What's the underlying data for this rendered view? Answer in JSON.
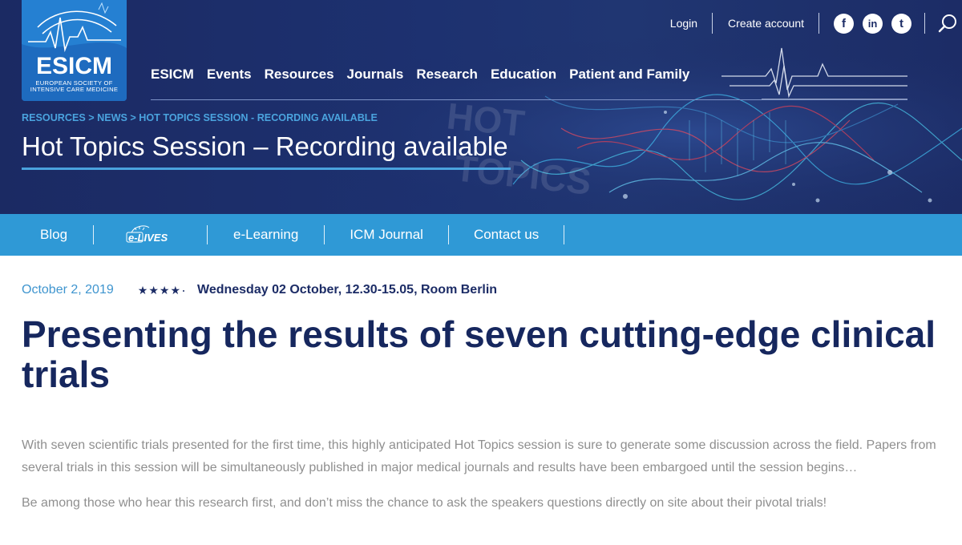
{
  "logo": {
    "name": "ESICM",
    "subtitle": "European Society of Intensive Care Medicine"
  },
  "topnav": {
    "login": "Login",
    "create_account": "Create account",
    "social": [
      {
        "icon": "facebook-icon",
        "glyph": "f"
      },
      {
        "icon": "linkedin-icon",
        "glyph": "in"
      },
      {
        "icon": "twitter-icon",
        "glyph": "t"
      }
    ],
    "search_icon": "search-icon"
  },
  "mainnav": [
    "ESICM",
    "Events",
    "Resources",
    "Journals",
    "Research",
    "Education",
    "Patient and Family"
  ],
  "breadcrumb": {
    "items": [
      "RESOURCES",
      "NEWS",
      "HOT TOPICS SESSION - RECORDING AVAILABLE"
    ],
    "separator": " > "
  },
  "page_title": "Hot Topics Session – Recording available",
  "banner_text": [
    "HOT",
    "TOPICS"
  ],
  "subnav": {
    "blog": "Blog",
    "elives_logo": "e-LIVES",
    "elearning": "e-Learning",
    "icm_journal": "ICM Journal",
    "contact": "Contact us"
  },
  "article": {
    "date": "October 2, 2019",
    "rating_stars": 4,
    "session_info": "Wednesday 02 October, 12.30-15.05, Room Berlin",
    "headline": "Presenting the results of seven cutting-edge clinical trials",
    "paragraphs": [
      "With seven scientific trials presented for the first time, this highly anticipated Hot Topics session is sure to generate some discussion across the field. Papers from several trials in this session will be simultaneously published in major medical journals and results have been embargoed until the session begins…",
      "Be among those who hear this research first, and don’t miss the chance to ask the speakers questions directly on site about their pivotal trials!"
    ]
  },
  "colors": {
    "header_bg": "#1c2c66",
    "accent_blue": "#2f99d6",
    "link_blue": "#4aa3de",
    "headline_navy": "#16275e",
    "body_gray": "#8f8f8f"
  }
}
